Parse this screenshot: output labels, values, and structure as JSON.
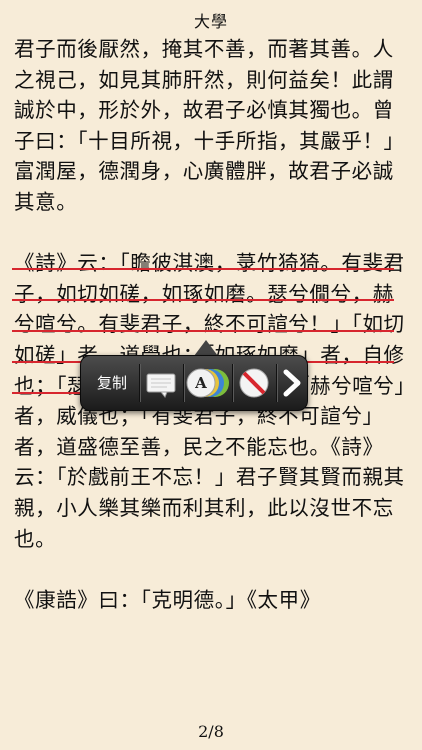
{
  "header": {
    "title": "大學"
  },
  "content": {
    "paragraph_1": "君子而後厭然，掩其不善，而著其善。人之視己，如見其肺肝然，則何益矣！此謂誠於中，形於外，故君子必慎其獨也。曾子曰：「十目所視，十手所指，其嚴乎！」富潤屋，德潤身，心廣體胖，故君子必誠其意。",
    "paragraph_2": "《詩》云：「瞻彼淇澳，菉竹猗猗。有斐君子，如切如磋，如琢如磨。瑟兮僩兮，赫兮喧兮。有斐君子，終不可諠兮！」「如切如磋」者，道學也；「如琢如磨」者，自修也；「瑟兮僩兮」者，恂慄也；「赫兮喧兮」者，威儀也；「有斐君子，終不可諠兮」者，道盛德至善，民之不能忘也。《詩》云：「於戲前王不忘！」君子賢其賢而親其親，小人樂其樂而利其利，此以沒世不忘也。",
    "paragraph_3": "《康誥》曰：「克明德。」《太甲》"
  },
  "selection_menu": {
    "copy_label": "复制",
    "icons": [
      "note-icon",
      "highlight-color-icon",
      "remove-highlight-icon",
      "more-arrow-icon"
    ],
    "colors": {
      "menu_background": "#2a2a2a",
      "highlight_underline": "#d7262e"
    }
  },
  "footer": {
    "page_indicator": "2/8"
  },
  "colors": {
    "page_background": "#f7ecd8",
    "text": "#111111"
  }
}
